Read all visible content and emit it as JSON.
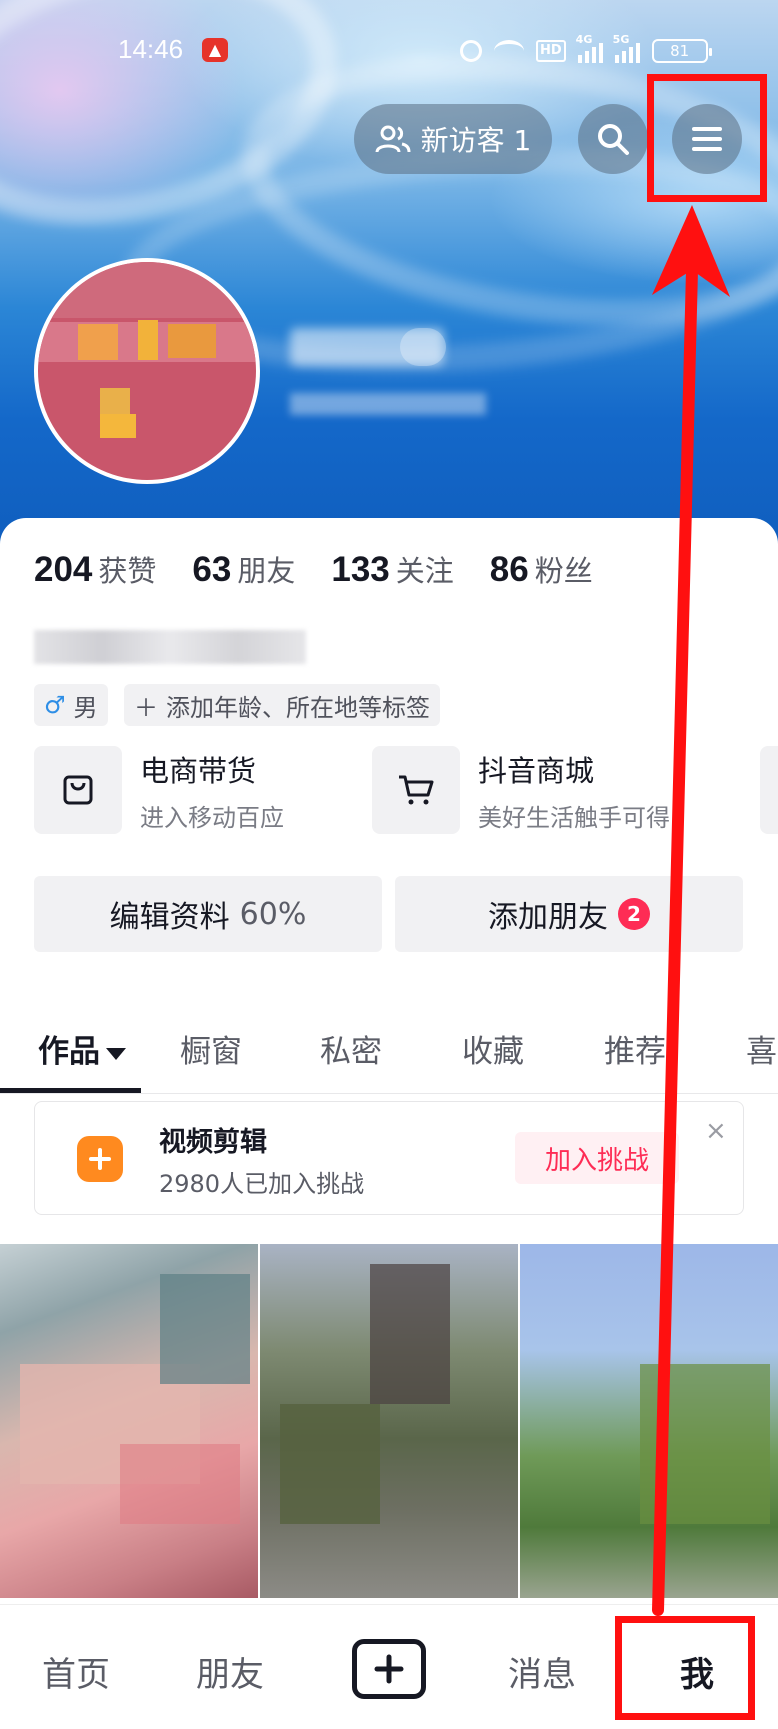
{
  "status_bar": {
    "time": "14:46",
    "battery": "81",
    "net_4g": "4G",
    "net_5g": "5G",
    "hd": "HD"
  },
  "header": {
    "visitor_label": "新访客 1"
  },
  "stats": [
    {
      "value": "204",
      "label": "获赞"
    },
    {
      "value": "63",
      "label": "朋友"
    },
    {
      "value": "133",
      "label": "关注"
    },
    {
      "value": "86",
      "label": "粉丝"
    }
  ],
  "tags": {
    "gender": "男",
    "add": "添加年龄、所在地等标签"
  },
  "services": [
    {
      "title": "电商带货",
      "subtitle": "进入移动百应",
      "icon": "bag-icon"
    },
    {
      "title": "抖音商城",
      "subtitle": "美好生活触手可得",
      "icon": "cart-icon"
    }
  ],
  "actions": {
    "edit_label": "编辑资料",
    "edit_progress": "60%",
    "add_friend_label": "添加朋友",
    "add_friend_badge": "2"
  },
  "tabs": [
    {
      "label": "作品",
      "active": true
    },
    {
      "label": "橱窗"
    },
    {
      "label": "私密"
    },
    {
      "label": "收藏"
    },
    {
      "label": "推荐"
    },
    {
      "label": "喜"
    }
  ],
  "challenge": {
    "title": "视频剪辑",
    "subtitle": "2980人已加入挑战",
    "button": "加入挑战",
    "close": "×"
  },
  "bottom_nav": {
    "home": "首页",
    "friends": "朋友",
    "messages": "消息",
    "me": "我"
  },
  "colors": {
    "accent": "#fe2c55",
    "annotation": "#ff1010",
    "challenge_icon": "#ff8a1f",
    "gender": "#2e8ee6"
  }
}
